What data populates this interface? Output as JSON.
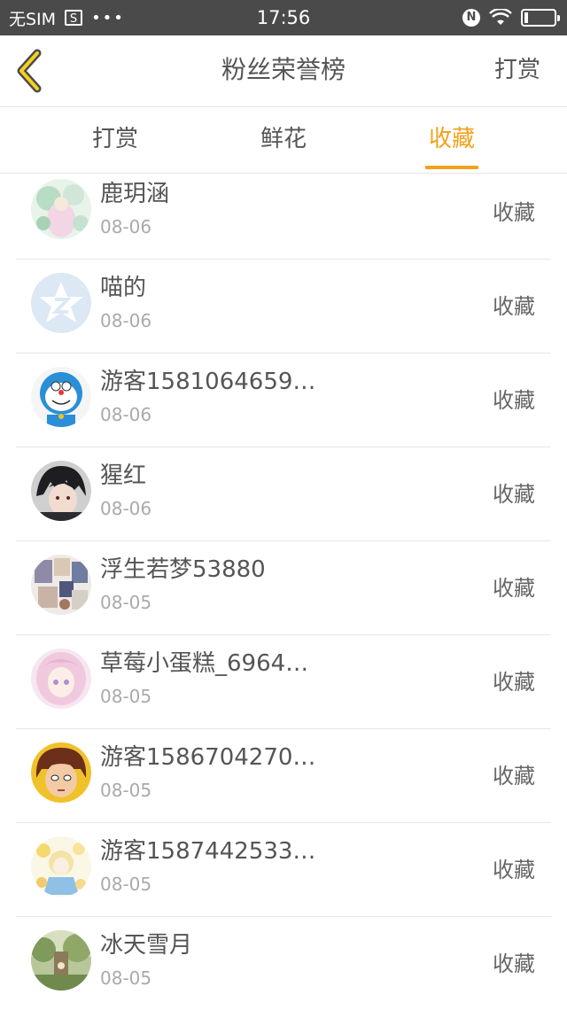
{
  "status_bar": {
    "carrier": "无SIM",
    "s_icon": "S",
    "dots": "•••",
    "time": "17:56",
    "nfc_label": "N"
  },
  "header": {
    "title": "粉丝荣誉榜",
    "action_label": "打赏"
  },
  "tabs": [
    {
      "label": "打赏",
      "active": false
    },
    {
      "label": "鲜花",
      "active": false
    },
    {
      "label": "收藏",
      "active": true
    }
  ],
  "items": [
    {
      "name": "鹿玥涵",
      "date": "08-06",
      "action": "收藏",
      "avatar": "pastel-garden-avatar"
    },
    {
      "name": "喵的",
      "date": "08-06",
      "action": "收藏",
      "avatar": "default-star-avatar"
    },
    {
      "name": "游客1581064659…",
      "date": "08-06",
      "action": "收藏",
      "avatar": "blue-cat-avatar"
    },
    {
      "name": "猩红",
      "date": "08-06",
      "action": "收藏",
      "avatar": "dark-hair-avatar"
    },
    {
      "name": "浮生若梦53880",
      "date": "08-05",
      "action": "收藏",
      "avatar": "collage-avatar"
    },
    {
      "name": "草莓小蛋糕_6964…",
      "date": "08-05",
      "action": "收藏",
      "avatar": "pink-girl-avatar"
    },
    {
      "name": "游客1586704270…",
      "date": "08-05",
      "action": "收藏",
      "avatar": "brown-hair-boy-avatar"
    },
    {
      "name": "游客1587442533…",
      "date": "08-05",
      "action": "收藏",
      "avatar": "flower-girl-avatar"
    },
    {
      "name": "冰天雪月",
      "date": "08-05",
      "action": "收藏",
      "avatar": "forest-avatar"
    }
  ],
  "colors": {
    "accent": "#f0a21c",
    "status_bar": "#4a4a4a",
    "divider": "#e6e6e6"
  }
}
